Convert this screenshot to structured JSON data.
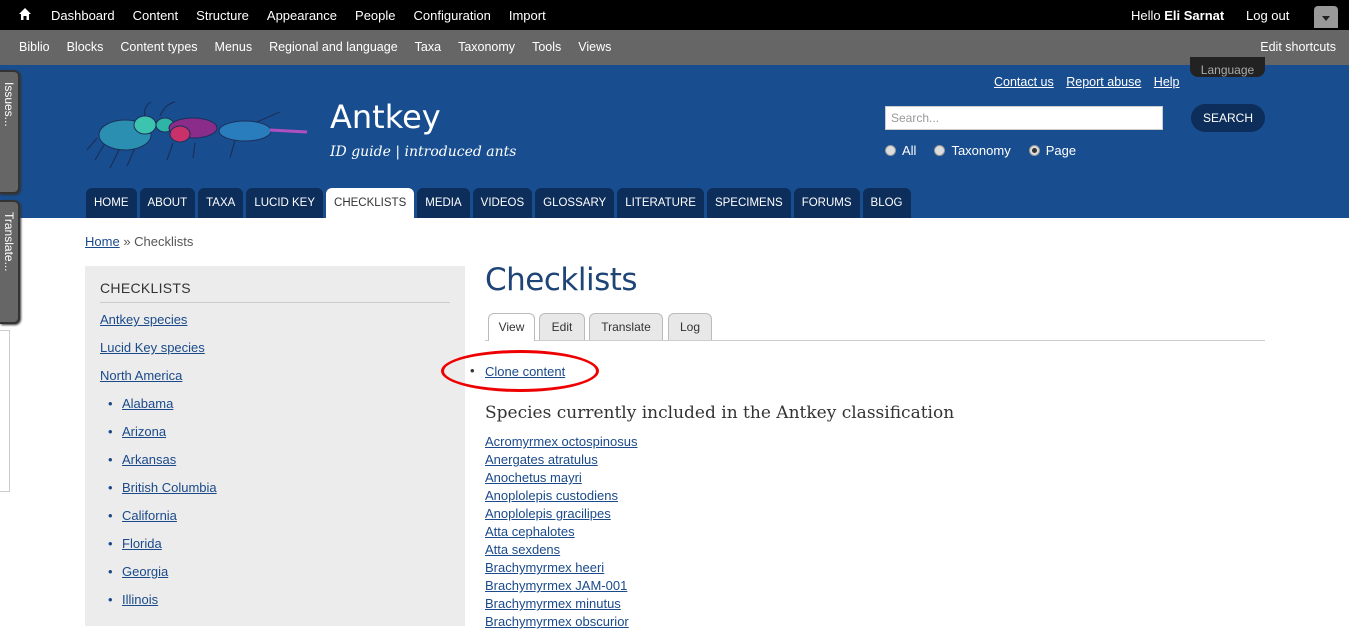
{
  "admin_bar": {
    "menu": [
      "Dashboard",
      "Content",
      "Structure",
      "Appearance",
      "People",
      "Configuration",
      "Import"
    ],
    "hello_prefix": "Hello",
    "user_name": "Eli Sarnat",
    "logout": "Log out"
  },
  "shortcuts": {
    "items": [
      "Biblio",
      "Blocks",
      "Content types",
      "Menus",
      "Regional and language",
      "Taxa",
      "Taxonomy",
      "Tools",
      "Views"
    ],
    "edit": "Edit shortcuts"
  },
  "side_tabs": {
    "issues": "Issues...",
    "translate": "Translate..."
  },
  "header": {
    "site_name": "Antkey",
    "slogan": "ID guide | introduced ants",
    "top_links": [
      "Contact us",
      "Report abuse",
      "Help"
    ],
    "language": "Language",
    "search_placeholder": "Search...",
    "search_button": "SEARCH",
    "scope": [
      {
        "label": "All",
        "checked": false
      },
      {
        "label": "Taxonomy",
        "checked": false
      },
      {
        "label": "Page",
        "checked": true
      }
    ]
  },
  "main_menu": [
    "HOME",
    "ABOUT",
    "TAXA",
    "LUCID KEY",
    "CHECKLISTS",
    "MEDIA",
    "VIDEOS",
    "GLOSSARY",
    "LITERATURE",
    "SPECIMENS",
    "FORUMS",
    "BLOG"
  ],
  "main_menu_active": "CHECKLISTS",
  "breadcrumb": {
    "home": "Home",
    "separator": "»",
    "current": "Checklists"
  },
  "sidebar": {
    "title": "CHECKLISTS",
    "items": [
      {
        "label": "Antkey species",
        "sub": false
      },
      {
        "label": "Lucid Key species",
        "sub": false
      },
      {
        "label": "North America",
        "sub": false
      },
      {
        "label": "Alabama",
        "sub": true
      },
      {
        "label": "Arizona",
        "sub": true
      },
      {
        "label": "Arkansas",
        "sub": true
      },
      {
        "label": "British Columbia",
        "sub": true
      },
      {
        "label": "California",
        "sub": true
      },
      {
        "label": "Florida",
        "sub": true
      },
      {
        "label": "Georgia",
        "sub": true
      },
      {
        "label": "Illinois",
        "sub": true
      }
    ]
  },
  "content": {
    "title": "Checklists",
    "tabs": [
      "View",
      "Edit",
      "Translate",
      "Log"
    ],
    "active_tab": "View",
    "clone_link": "Clone content",
    "species_heading": "Species currently included in the Antkey classification",
    "species": [
      "Acromyrmex octospinosus",
      "Anergates atratulus",
      "Anochetus mayri",
      "Anoplolepis custodiens",
      "Anoplolepis gracilipes",
      "Atta cephalotes",
      "Atta sexdens",
      "Brachymyrmex heeri",
      "Brachymyrmex JAM-001",
      "Brachymyrmex minutus",
      "Brachymyrmex obscurior"
    ]
  },
  "colors": {
    "header_bg": "#184e8f",
    "menu_tab_bg": "#0d2d5a",
    "highlight": "#e00000"
  }
}
